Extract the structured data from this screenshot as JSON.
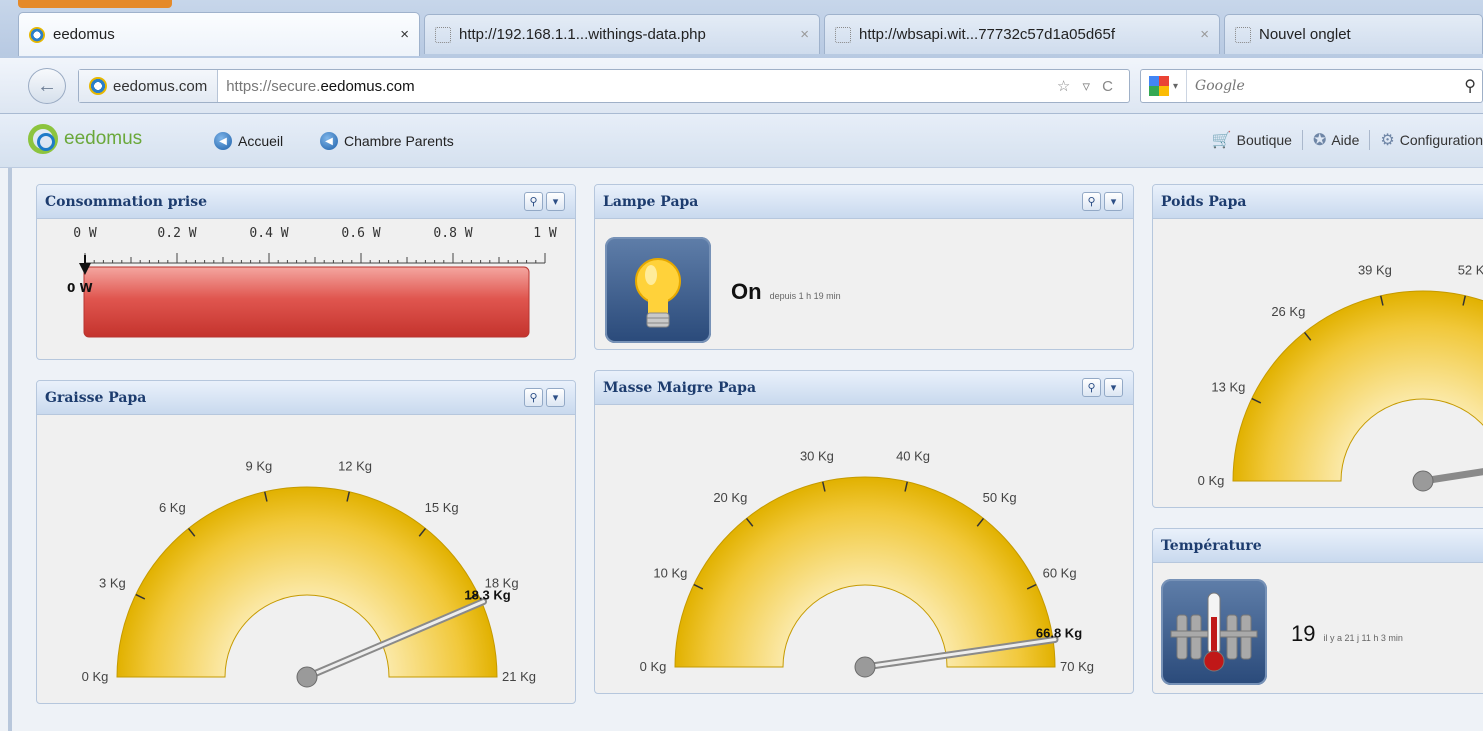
{
  "browser": {
    "tabs": [
      {
        "label": "eedomus",
        "close": "×",
        "active": true
      },
      {
        "label": "http://192.168.1.1...withings-data.php",
        "close": "×",
        "active": false
      },
      {
        "label": "http://wbsapi.wit...77732c57d1a05d65f",
        "close": "×",
        "active": false
      },
      {
        "label": "Nouvel onglet",
        "close": "",
        "active": false
      }
    ],
    "identity": "eedomus.com",
    "url_prefix": "https://secure.",
    "url_domain": "eedomus.com",
    "url_icons": "☆ ▿ C",
    "search_placeholder": "Google",
    "back_icon": "←",
    "search_icon": "⚲"
  },
  "app": {
    "logo_text": "eedomus",
    "breadcrumb": [
      "Accueil",
      "Chambre Parents"
    ],
    "right_links": [
      "Boutique",
      "Aide",
      "Configuration"
    ]
  },
  "widgets": {
    "consommation": {
      "title": "Consommation prise",
      "scale": [
        "0 W",
        "0.2 W",
        "0.4 W",
        "0.6 W",
        "0.8 W",
        "1 W"
      ],
      "value_label": "0 W",
      "value": 0,
      "max": 1
    },
    "lampe": {
      "title": "Lampe Papa",
      "state": "On",
      "since": "depuis 1 h 19 min",
      "icon": "bulb-icon"
    },
    "poids": {
      "title": "Poids Papa",
      "ticks": [
        "0 Kg",
        "13 Kg",
        "26 Kg",
        "39 Kg",
        "52 K"
      ]
    },
    "graisse": {
      "title": "Graisse Papa",
      "ticks": [
        "0 Kg",
        "3 Kg",
        "6 Kg",
        "9 Kg",
        "12 Kg",
        "15 Kg",
        "18 Kg",
        "21 Kg"
      ],
      "value_label": "18.3 Kg",
      "value": 18.3,
      "max": 21
    },
    "masse": {
      "title": "Masse Maigre Papa",
      "ticks": [
        "0 Kg",
        "10 Kg",
        "20 Kg",
        "30 Kg",
        "40 Kg",
        "50 Kg",
        "60 Kg",
        "70 Kg"
      ],
      "value_label": "66.8 Kg",
      "value": 66.8,
      "max": 70
    },
    "temperature": {
      "title": "Température",
      "value": "19",
      "since": "il y a 21 j 11 h 3 min",
      "icon": "thermometer-icon"
    }
  },
  "colors": {
    "gauge_gold": "#e1b100",
    "gauge_light": "#fbe9a8",
    "bar_red": "#e0564f",
    "header_blue": "#1d3c6e"
  }
}
